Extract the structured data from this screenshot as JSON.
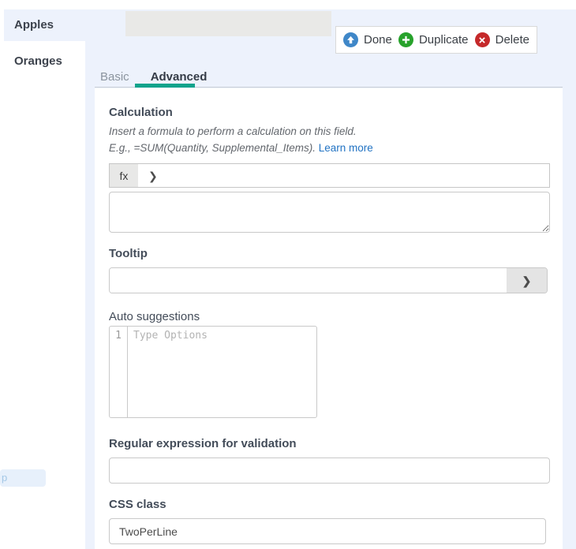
{
  "colors": {
    "page_bg": "#edf2fc",
    "panel_bg": "#ffffff",
    "accent_teal": "#10a38b",
    "link_blue": "#2273c3",
    "done_icon_blue": "#3f87c8",
    "duplicate_icon_green": "#27a22b",
    "delete_icon_red": "#c5292a",
    "label_text": "#434c59",
    "input_border": "#c9c9c9",
    "disabled_input_bg": "#e9e9e7"
  },
  "icons": {
    "done_icon": "arrow-up-in-blue-circle",
    "duplicate_icon": "plus-in-green-circle",
    "delete_icon": "x-in-red-circle",
    "chevron_right_icon": "❯"
  },
  "field_list": {
    "selected_field": {
      "label": "Apples",
      "title_input_value": ""
    },
    "other_field": {
      "label": "Oranges"
    },
    "clipped_chip_text": "p"
  },
  "toolbar": {
    "done_label": "Done",
    "duplicate_label": "Duplicate",
    "delete_label": "Delete"
  },
  "tabs": {
    "basic": "Basic",
    "advanced": "Advanced",
    "active": "Advanced"
  },
  "panel": {
    "calculation": {
      "label": "Calculation",
      "help_line1": "Insert a formula to perform a calculation on this field.",
      "help_line2": "E.g., =SUM(Quantity, Supplemental_Items).",
      "learn_more": "Learn more",
      "fx_button": "fx",
      "formula_value": ""
    },
    "tooltip": {
      "label": "Tooltip",
      "value": ""
    },
    "auto_suggestions": {
      "label": "Auto suggestions",
      "line_number": "1",
      "placeholder": "Type Options"
    },
    "regex": {
      "label": "Regular expression for validation",
      "value": ""
    },
    "css_class": {
      "label": "CSS class",
      "value": "TwoPerLine"
    }
  }
}
